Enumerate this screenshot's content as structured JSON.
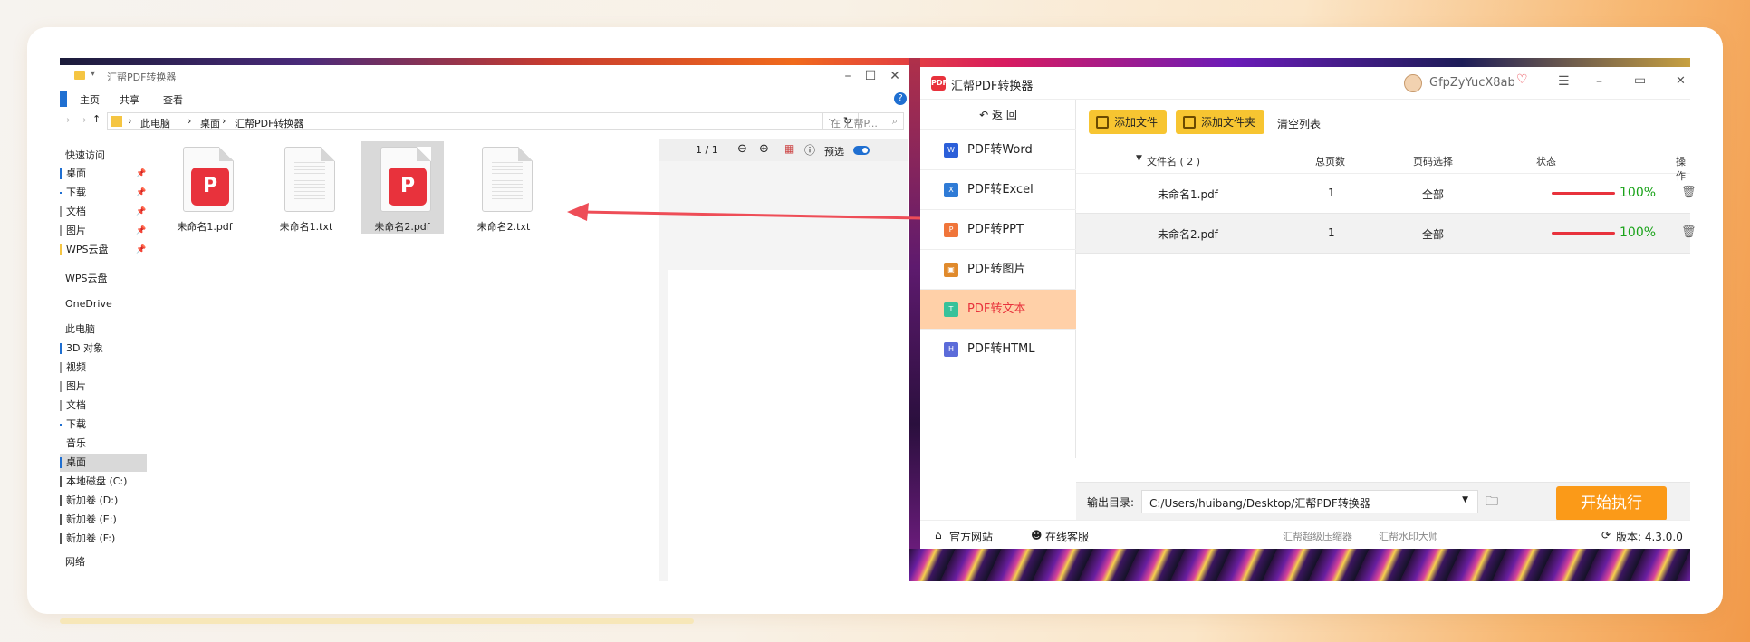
{
  "explorer": {
    "title": "汇帮PDF转换器",
    "ribbon_tabs": [
      "主页",
      "共享",
      "查看"
    ],
    "breadcrumb": [
      "此电脑",
      "桌面",
      "汇帮PDF转换器"
    ],
    "search_placeholder": "在 汇帮P...",
    "nav": {
      "quick_access": "快速访问",
      "quick_items": [
        "桌面",
        "下载",
        "文档",
        "图片",
        "WPS云盘"
      ],
      "wps": "WPS云盘",
      "onedrive": "OneDrive",
      "this_pc": "此电脑",
      "pc_items": [
        "3D 对象",
        "视频",
        "图片",
        "文档",
        "下载",
        "音乐",
        "桌面",
        "本地磁盘 (C:)",
        "新加卷 (D:)",
        "新加卷 (E:)",
        "新加卷 (F:)"
      ],
      "network": "网络"
    },
    "files": [
      {
        "name": "未命名1.pdf",
        "type": "pdf"
      },
      {
        "name": "未命名1.txt",
        "type": "txt"
      },
      {
        "name": "未命名2.pdf",
        "type": "pdf"
      },
      {
        "name": "未命名2.txt",
        "type": "txt"
      }
    ],
    "preview": {
      "page": "1 / 1",
      "label": "预选"
    }
  },
  "app": {
    "title": "汇帮PDF转换器",
    "username": "GfpZyYucX8ab",
    "back_label": "返 回",
    "sidebar": [
      {
        "label": "PDF转Word",
        "icon": "word-icon",
        "color": "#2b5fd9"
      },
      {
        "label": "PDF转Excel",
        "icon": "excel-icon",
        "color": "#2f7bd6"
      },
      {
        "label": "PDF转PPT",
        "icon": "ppt-icon",
        "color": "#f0753a"
      },
      {
        "label": "PDF转图片",
        "icon": "image-icon",
        "color": "#e08a2c"
      },
      {
        "label": "PDF转文本",
        "icon": "text-icon",
        "color": "#37c29a"
      },
      {
        "label": "PDF转HTML",
        "icon": "html-icon",
        "color": "#5b6bd9"
      }
    ],
    "active_index": 4,
    "toolbar": {
      "add_file": "添加文件",
      "add_folder": "添加文件夹",
      "clear": "清空列表"
    },
    "columns": {
      "name": "文件名 ( 2 )",
      "pages": "总页数",
      "range": "页码选择",
      "status": "状态",
      "action": "操作"
    },
    "rows": [
      {
        "name": "未命名1.pdf",
        "pages": "1",
        "range": "全部",
        "progress": 100,
        "progress_label": "100%"
      },
      {
        "name": "未命名2.pdf",
        "pages": "1",
        "range": "全部",
        "progress": 100,
        "progress_label": "100%"
      }
    ],
    "output": {
      "label": "输出目录:",
      "path": "C:/Users/huibang/Desktop/汇帮PDF转换器"
    },
    "start_label": "开始执行",
    "footer": {
      "site": "官方网站",
      "service": "在线客服",
      "compress": "汇帮超级压缩器",
      "watermark": "汇帮水印大师",
      "version": "版本: 4.3.0.0"
    },
    "colors": {
      "accent": "#f7c531",
      "start": "#fb9a18",
      "active_bg": "#ffd0a8",
      "progress": "#1aa31a",
      "bar": "#e8323c"
    }
  }
}
